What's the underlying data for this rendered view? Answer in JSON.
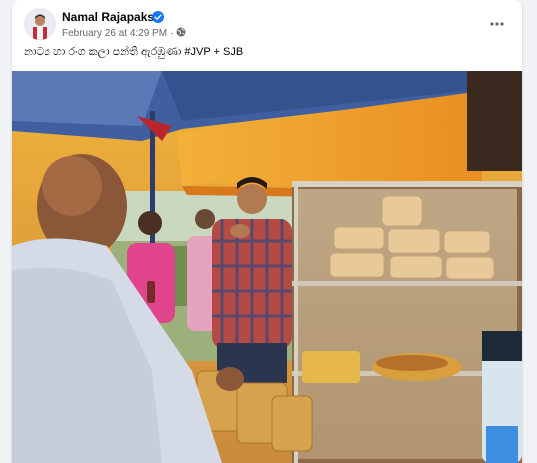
{
  "post": {
    "author": "Namal Rajapaksa",
    "date": "February 26 at 4:29 PM",
    "separator": "·",
    "text": "නාට්‍ය හා රංග කලා පන්ති ඇරඹුණා #JVP + SJB",
    "icons": {
      "verified": "verified-badge-icon",
      "audience": "globe-icon",
      "more": "more-options-icon"
    }
  },
  "colors": {
    "brand_blue": "#1877f2",
    "card_bg": "#ffffff",
    "page_bg": "#f0f2f5",
    "text_primary": "#050505",
    "text_secondary": "#65676b"
  }
}
